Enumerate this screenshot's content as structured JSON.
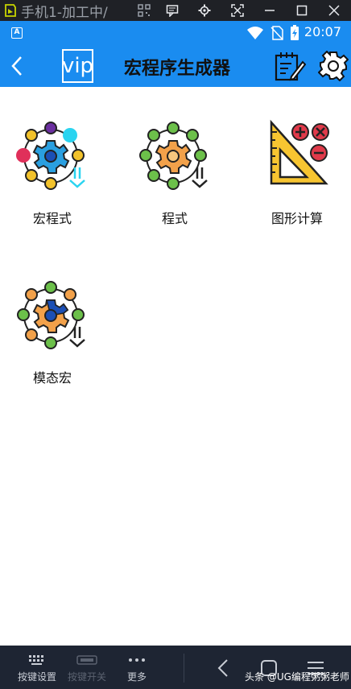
{
  "window": {
    "title": "手机1-加工中/",
    "icons": [
      "app-logo-icon",
      "qr-icon",
      "chat-icon",
      "gear-icon",
      "fullscreen-icon",
      "minimize-icon",
      "maximize-icon",
      "close-icon"
    ]
  },
  "status_bar": {
    "time": "20:07",
    "left_badge": "A"
  },
  "header": {
    "badge": "vip",
    "title": "宏程序生成器"
  },
  "grid": {
    "items": [
      {
        "label": "宏程式",
        "icon": "gear-cycle-macro-icon"
      },
      {
        "label": "程式",
        "icon": "gear-cycle-program-icon"
      },
      {
        "label": "图形计算",
        "icon": "triangle-ruler-calculator-icon"
      },
      {
        "label": "模态宏",
        "icon": "gear-cycle-modal-icon"
      }
    ]
  },
  "toolbar": {
    "keymap_label": "按键设置",
    "keyswitch_label": "按键开关",
    "more_label": "更多",
    "watermark": "头条 @UG编程粥粥老师"
  },
  "colors": {
    "accent": "#1a8cf0",
    "toolbar_bg": "#1e2533",
    "window_bar": "#1f2126"
  }
}
